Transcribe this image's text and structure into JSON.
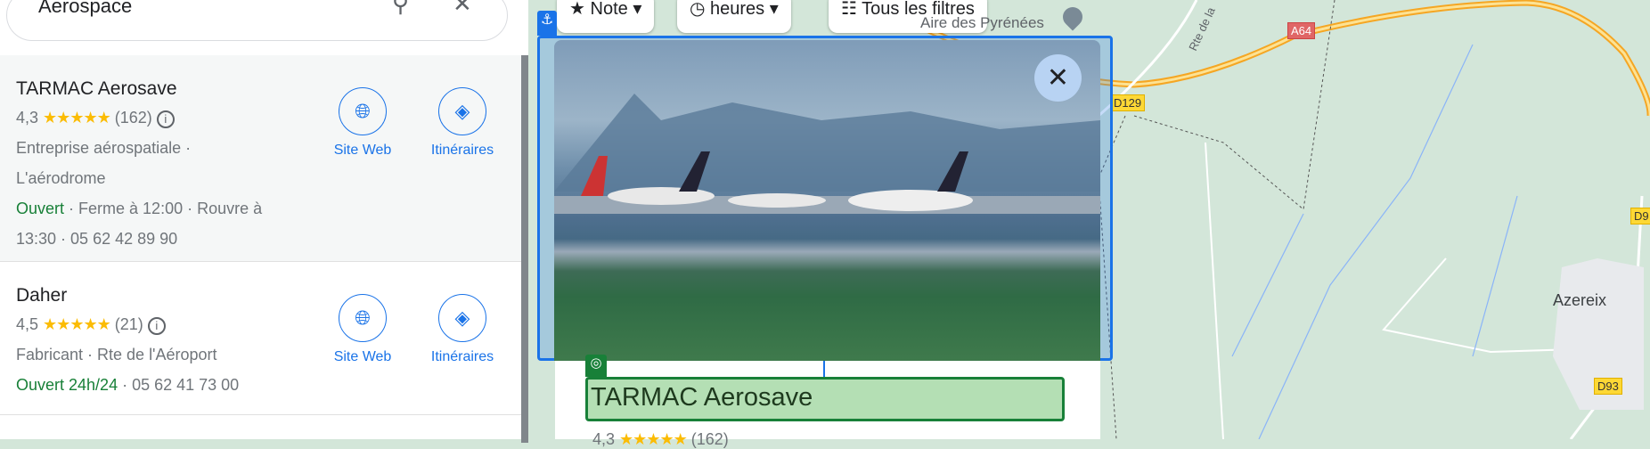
{
  "search": {
    "query": "Aerospace",
    "search_icon": "search-icon",
    "clear_icon": "close-icon"
  },
  "results": [
    {
      "name": "TARMAC Aerosave",
      "rating": "4,3",
      "stars": "★★★★★",
      "reviews": "(162)",
      "category": "Entreprise aérospatiale ·",
      "address": "L'aérodrome",
      "status": "Ouvert",
      "hours": " · Ferme à 12:00 · Rouvre à",
      "hours2": "13:30 · 05 62 42 89 90",
      "website": "Site Web",
      "directions": "Itinéraires"
    },
    {
      "name": "Daher",
      "rating": "4,5",
      "stars": "★★★★★",
      "reviews": "(21)",
      "category": "Fabricant · Rte de l'Aéroport",
      "status": "Ouvert 24h/24",
      "phone": " · 05 62 41 73 00",
      "website": "Site Web",
      "directions": "Itinéraires"
    }
  ],
  "filters": {
    "rating": "Note",
    "hours": "heures",
    "all": "Tous les filtres"
  },
  "map": {
    "place_label": "Aire des Pyrénées",
    "road_a64": "A64",
    "road_d129": "D129",
    "road_rte": "Rte de la",
    "road_d93": "D93",
    "road_d9": "D9",
    "town": "Azereix"
  },
  "preview": {
    "title": "TARMAC Aerosave",
    "rating": "4,3",
    "stars": "★★★★★",
    "reviews": "(162)"
  },
  "colors": {
    "accent": "#1a73e8",
    "open": "#188038",
    "star": "#fbbc04"
  }
}
